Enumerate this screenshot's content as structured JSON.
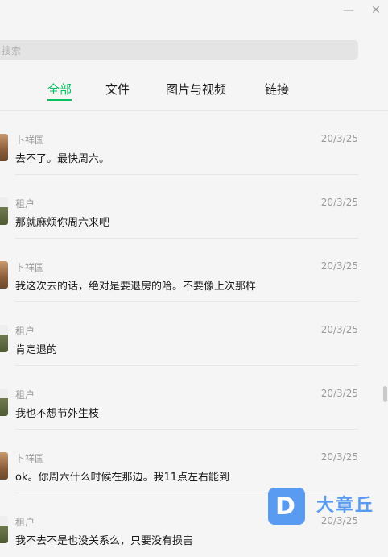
{
  "window": {
    "minimize_glyph": "—",
    "close_glyph": "✕"
  },
  "search": {
    "placeholder": "搜索"
  },
  "tabs": [
    {
      "label": "全部",
      "active": true
    },
    {
      "label": "文件",
      "active": false
    },
    {
      "label": "图片与视频",
      "active": false
    },
    {
      "label": "链接",
      "active": false
    }
  ],
  "messages": [
    {
      "sender": "卜祥国",
      "date": "20/3/25",
      "text": "去不了。最快周六。",
      "avatar": "photo-avatar"
    },
    {
      "sender": "租户",
      "date": "20/3/25",
      "text": "那就麻烦你周六来吧",
      "avatar": "landscape-avatar"
    },
    {
      "sender": "卜祥国",
      "date": "20/3/25",
      "text": "我这次去的话，绝对是要退房的哈。不要像上次那样",
      "avatar": "photo-avatar"
    },
    {
      "sender": "租户",
      "date": "20/3/25",
      "text": "肯定退的",
      "avatar": "landscape-avatar"
    },
    {
      "sender": "租户",
      "date": "20/3/25",
      "text": "我也不想节外生枝",
      "avatar": "landscape-avatar"
    },
    {
      "sender": "卜祥国",
      "date": "20/3/25",
      "text": "ok。你周六什么时候在那边。我11点左右能到",
      "avatar": "photo-avatar"
    },
    {
      "sender": "租户",
      "date": "20/3/25",
      "text": "我不去不是也没关系么，只要没有损害",
      "avatar": "landscape-avatar"
    }
  ],
  "watermark": {
    "logo_letter": "D",
    "text": "大章丘"
  },
  "colors": {
    "accent": "#07c160",
    "watermark": "#3d8cf0"
  }
}
